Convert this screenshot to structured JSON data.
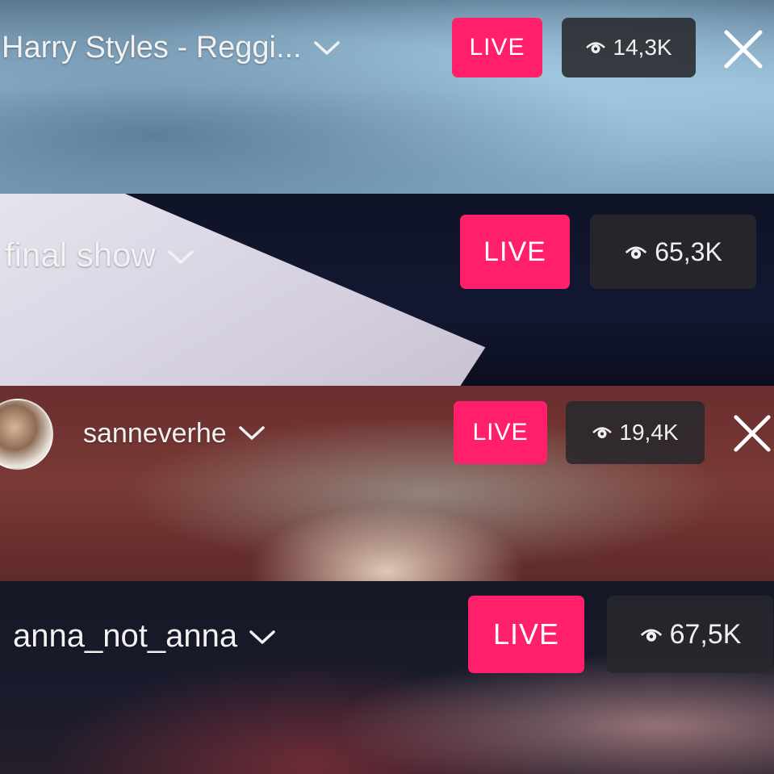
{
  "colors": {
    "live_pink": "#ff1f6b",
    "views_bg": "#2a2a2e"
  },
  "streams": [
    {
      "title": "Harry Styles - Reggi...",
      "live_label": "LIVE",
      "viewers": "14,3K",
      "has_close": true,
      "has_avatar": false
    },
    {
      "title": "final show",
      "live_label": "LIVE",
      "viewers": "65,3K",
      "has_close": false,
      "has_avatar": false
    },
    {
      "title": "sanneverhe",
      "live_label": "LIVE",
      "viewers": "19,4K",
      "has_close": true,
      "has_avatar": true
    },
    {
      "title": "anna_not_anna",
      "live_label": "LIVE",
      "viewers": "67,5K",
      "has_close": false,
      "has_avatar": false
    }
  ],
  "icons": {
    "chevron": "chevron-down-icon",
    "eye": "eye-icon",
    "close": "close-icon",
    "avatar": "avatar"
  }
}
